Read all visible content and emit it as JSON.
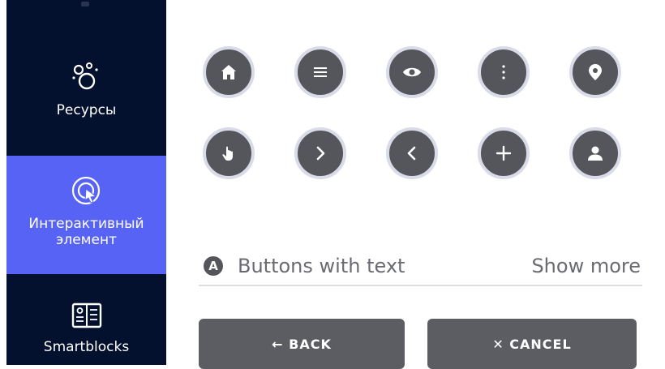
{
  "sidebar": {
    "items": [
      {
        "label": "Ресурсы",
        "icon": "resources-icon"
      },
      {
        "label_line1": "Интерактивный",
        "label_line2": "элемент",
        "icon": "interactive-cursor-icon",
        "active": true
      },
      {
        "label": "Smartblocks",
        "icon": "smartblocks-icon"
      }
    ],
    "colors": {
      "background": "#03102e",
      "active": "#5663f5"
    }
  },
  "icon_buttons": {
    "row1": [
      "home-icon",
      "menu-icon",
      "eye-icon",
      "more-vertical-icon",
      "location-pin-icon"
    ],
    "row2": [
      "touch-icon",
      "chevron-right-icon",
      "chevron-left-icon",
      "plus-icon",
      "user-icon"
    ]
  },
  "section": {
    "badge": "A",
    "title": "Buttons with text",
    "show_more": "Show more"
  },
  "buttons": {
    "back": "← BACK",
    "cancel": "✕ CANCEL"
  }
}
